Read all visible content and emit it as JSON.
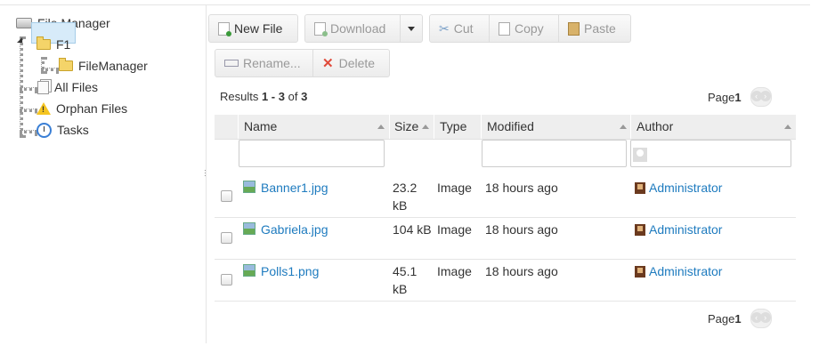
{
  "tree": {
    "root": "File Manager",
    "f1": "F1",
    "filemanager": "FileManager",
    "all_files": "All Files",
    "orphan_files": "Orphan Files",
    "tasks": "Tasks"
  },
  "toolbar": {
    "new_file": "New File",
    "download": "Download",
    "cut": "Cut",
    "copy": "Copy",
    "paste": "Paste",
    "rename": "Rename...",
    "delete": "Delete"
  },
  "results": {
    "prefix": "Results ",
    "range": "1 - 3",
    "of": " of ",
    "total": "3"
  },
  "pager": {
    "label": "Page ",
    "page": "1"
  },
  "columns": {
    "name": "Name",
    "size": "Size",
    "type": "Type",
    "modified": "Modified",
    "author": "Author"
  },
  "rows": [
    {
      "name": "Banner1.jpg",
      "size_line1": "23.2",
      "size_line2": "kB",
      "type": "Image",
      "modified": "18 hours ago",
      "author": "Administrator"
    },
    {
      "name": "Gabriela.jpg",
      "size_line1": "104 kB",
      "size_line2": "",
      "type": "Image",
      "modified": "18 hours ago",
      "author": "Administrator"
    },
    {
      "name": "Polls1.png",
      "size_line1": "45.1",
      "size_line2": "kB",
      "type": "Image",
      "modified": "18 hours ago",
      "author": "Administrator"
    }
  ],
  "colors": {
    "link": "#1e7bbf",
    "selected_bg": "#d7ebf9",
    "header_bg": "#eeeeee"
  }
}
